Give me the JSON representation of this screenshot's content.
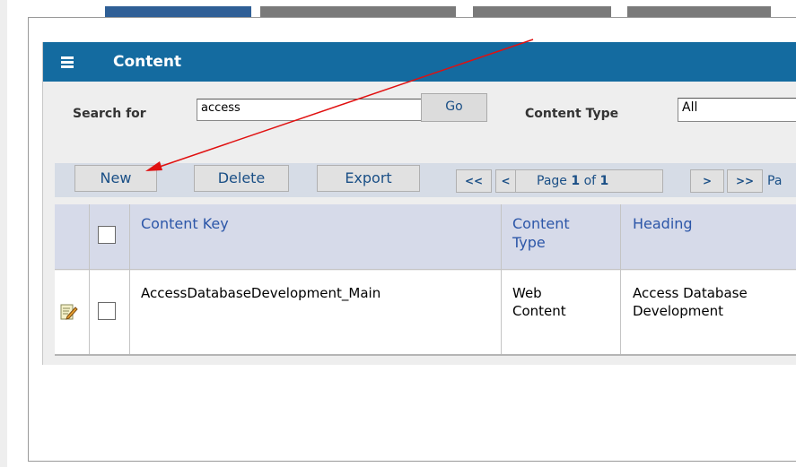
{
  "panel": {
    "title": "Content",
    "menu_icon": "menu-icon"
  },
  "search": {
    "label": "Search for",
    "value": "access",
    "go_label": "Go"
  },
  "filter": {
    "content_type_label": "Content Type",
    "content_type_value": "All"
  },
  "toolbar": {
    "new_label": "New",
    "delete_label": "Delete",
    "export_label": "Export",
    "first_label": "<<",
    "prev_label": "<",
    "page_prefix": "Page",
    "page_current": "1",
    "page_of": "of",
    "page_total": "1",
    "next_label": ">",
    "last_label": ">>",
    "trailing_text": "Pa"
  },
  "table": {
    "headers": {
      "content_key": "Content Key",
      "content_type_line1": "Content",
      "content_type_line2": "Type",
      "heading": "Heading"
    },
    "rows": [
      {
        "content_key": "AccessDatabaseDevelopment_Main",
        "content_type_line1": "Web",
        "content_type_line2": "Content",
        "heading_line1": "Access Database",
        "heading_line2": "Development",
        "edit_icon": "edit-icon"
      }
    ]
  },
  "colors": {
    "header_bg": "#146ba0",
    "tab_active": "#2f5f96",
    "link_blue": "#1a4f86",
    "annotation_arrow": "#e01010"
  }
}
